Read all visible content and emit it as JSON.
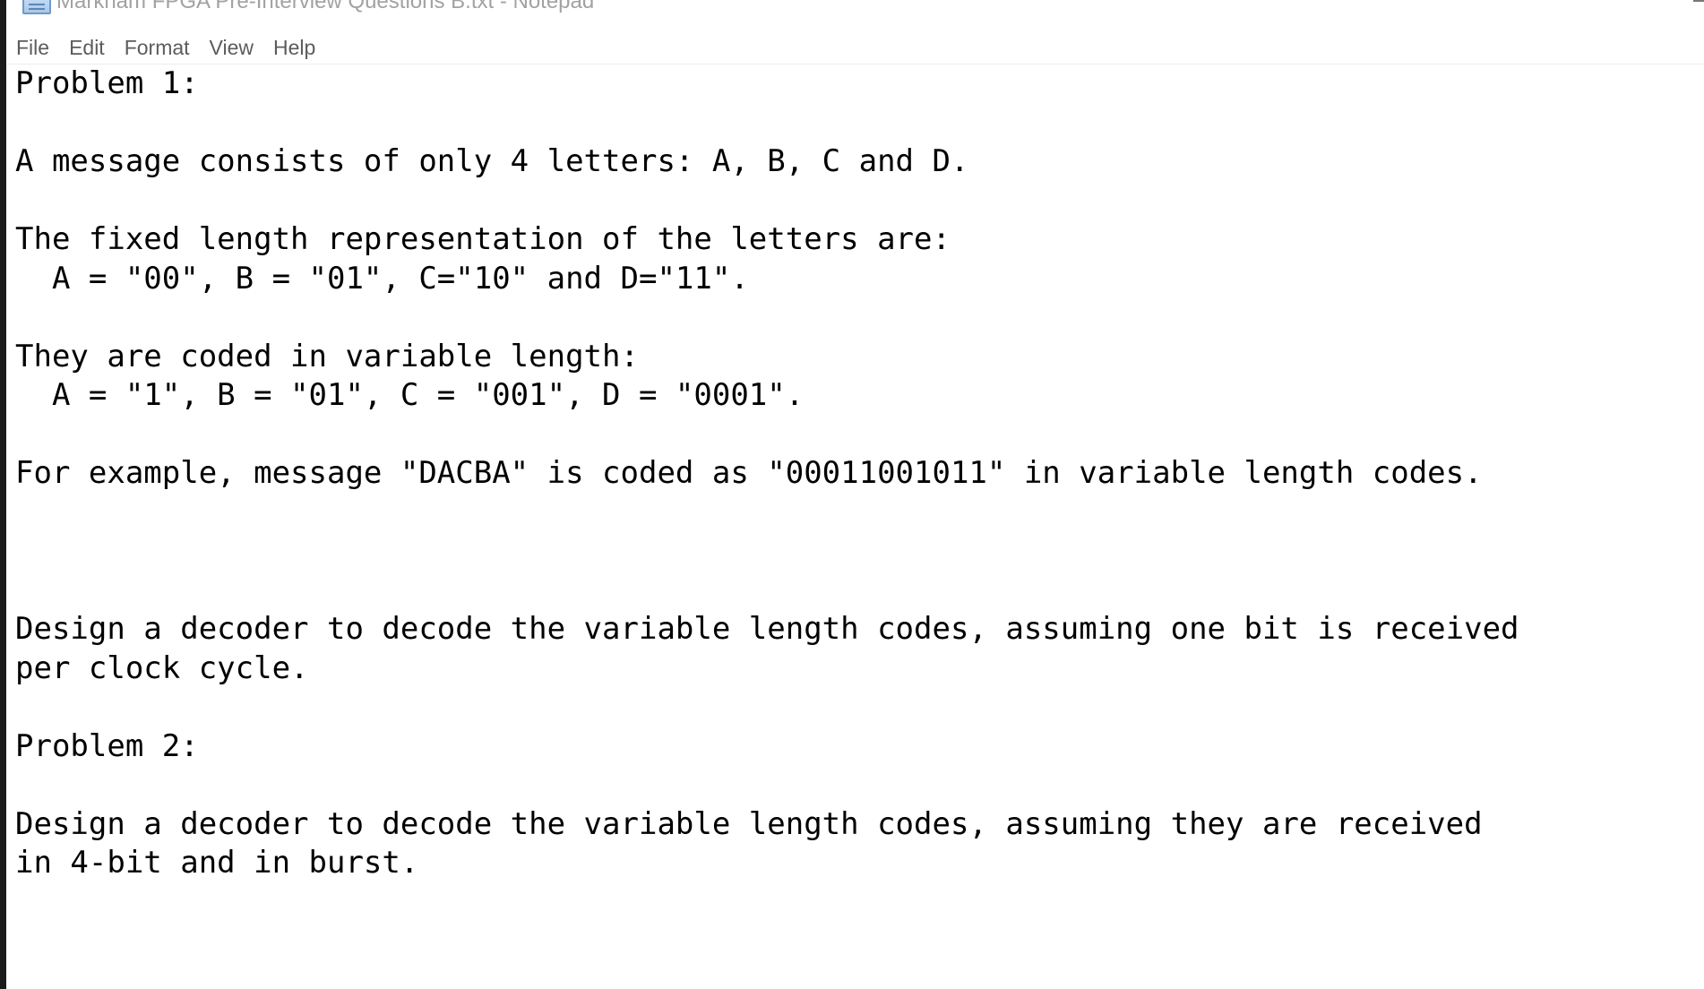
{
  "window": {
    "title": "Markham FPGA Pre-Interview Questions B.txt - Notepad"
  },
  "menu": {
    "items": [
      "File",
      "Edit",
      "Format",
      "View",
      "Help"
    ]
  },
  "editor": {
    "lines": [
      "Problem 1:",
      "",
      "A message consists of only 4 letters: A, B, C and D.",
      "",
      "The fixed length representation of the letters are:",
      "  A = \"00\", B = \"01\", C=\"10\" and D=\"11\".",
      "",
      "They are coded in variable length:",
      "  A = \"1\", B = \"01\", C = \"001\", D = \"0001\".",
      "",
      "For example, message \"DACBA\" is coded as \"00011001011\" in variable length codes.",
      "",
      "",
      "",
      "Design a decoder to decode the variable length codes, assuming one bit is received",
      "per clock cycle.",
      "",
      "Problem 2:",
      "",
      "Design a decoder to decode the variable length codes, assuming they are received",
      "in 4-bit and in burst."
    ]
  },
  "colors": {
    "title_text": "#a2a2a2",
    "menu_text": "#5c5c5c",
    "editor_text": "#000000",
    "background": "#ffffff"
  }
}
